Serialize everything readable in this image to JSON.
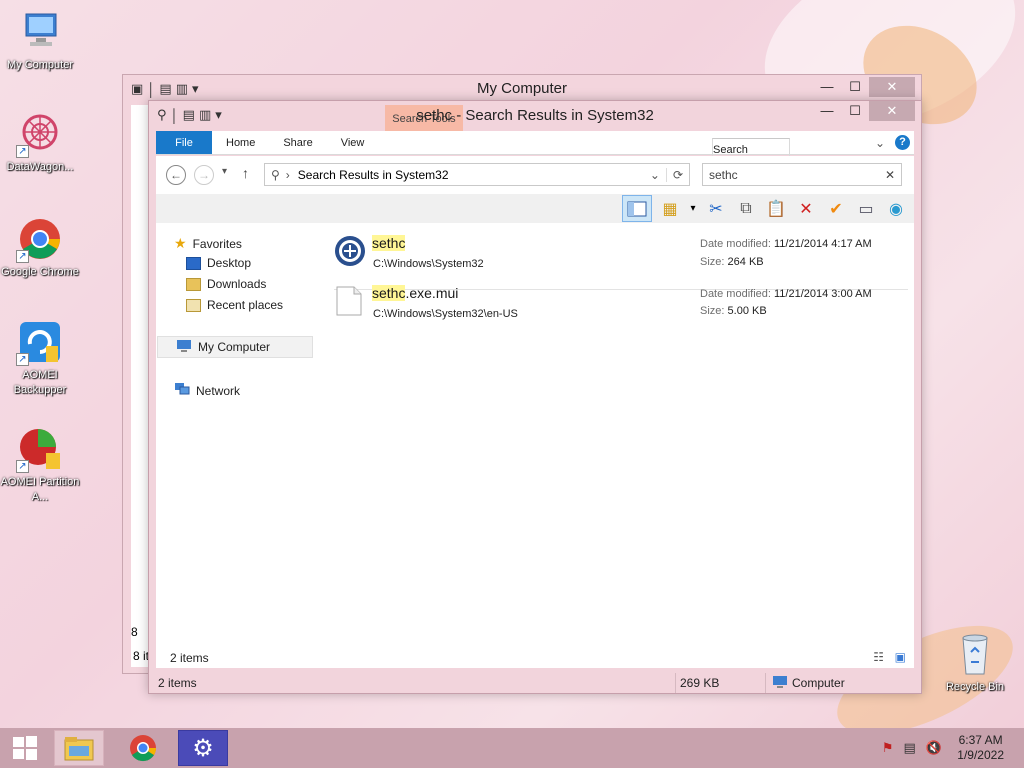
{
  "desktop": {
    "icons": [
      {
        "label": "My Computer"
      },
      {
        "label": "DataWagon..."
      },
      {
        "label": "Google Chrome"
      },
      {
        "label": "AOMEI Backupper"
      },
      {
        "label": "AOMEI Partition A..."
      },
      {
        "label": "Recycle Bin"
      }
    ]
  },
  "back_window": {
    "title": "My Computer",
    "status_fragment": "8 it",
    "side_fragment": "8"
  },
  "window": {
    "title": "sethc - Search Results in System32",
    "contextual_tab_group": "Search Tools",
    "ribbon_tabs": [
      "File",
      "Home",
      "Share",
      "View",
      "Search"
    ],
    "address": {
      "path": "Search Results in System32"
    },
    "search": {
      "value": "sethc",
      "clear": "✕"
    },
    "nav": {
      "favorites": "Favorites",
      "desktop": "Desktop",
      "downloads": "Downloads",
      "recent": "Recent places",
      "computer": "My Computer",
      "network": "Network"
    },
    "results": [
      {
        "name_highlight": "sethc",
        "name_rest": "",
        "path": "C:\\Windows\\System32",
        "date_label": "Date modified:",
        "date": "11/21/2014 4:17 AM",
        "size_label": "Size:",
        "size": "264 KB"
      },
      {
        "name_highlight": "sethc",
        "name_rest": ".exe.mui",
        "path": "C:\\Windows\\System32\\en-US",
        "date_label": "Date modified:",
        "date": "11/21/2014 3:00 AM",
        "size_label": "Size:",
        "size": "5.00 KB"
      }
    ],
    "inner_status": "2 items",
    "outer_status": {
      "items": "2 items",
      "size": "269 KB",
      "location": "Computer"
    }
  },
  "taskbar": {
    "time": "6:37 AM",
    "date": "1/9/2022"
  },
  "colors": {
    "accent": "#1979ca",
    "highlight": "#fff696",
    "search_tools_tab": "#f7b9a6"
  }
}
